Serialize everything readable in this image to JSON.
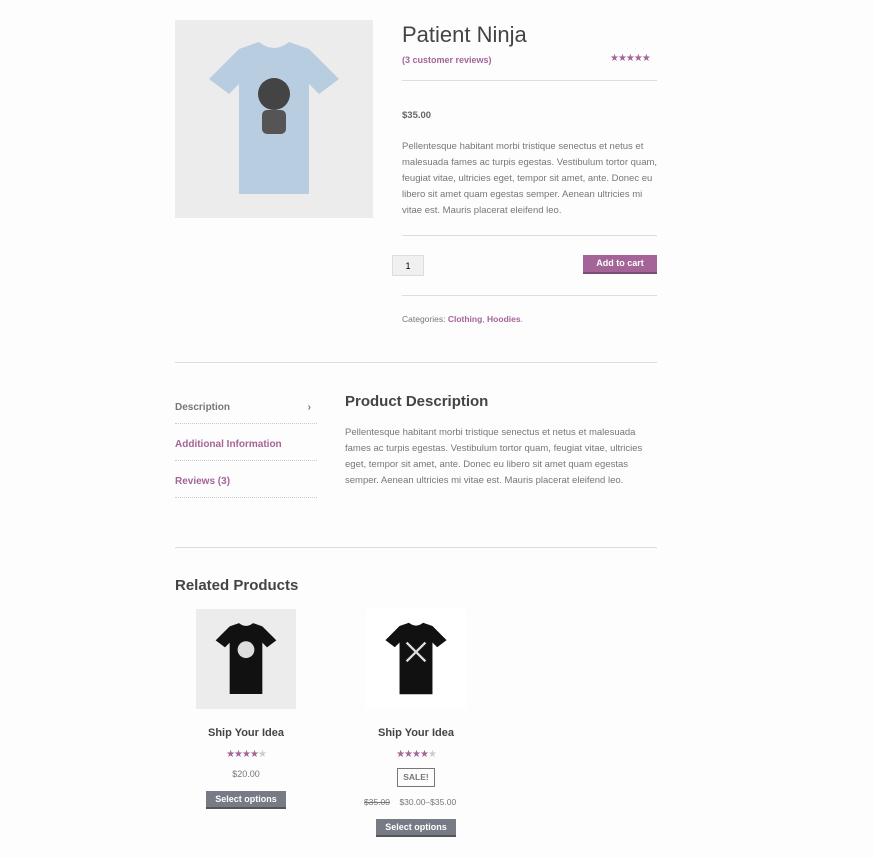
{
  "product": {
    "title": "Patient Ninja",
    "reviews_link": "(3 customer reviews)",
    "rating": 4.67,
    "price": "$35.00",
    "description": "Pellentesque habitant morbi tristique senectus et netus et malesuada fames ac turpis egestas. Vestibulum tortor quam, feugiat vitae, ultricies eget, tempor sit amet, ante. Donec eu libero sit amet quam egestas semper. Aenean ultricies mi vitae est. Mauris placerat eleifend leo.",
    "quantity": "1",
    "add_to_cart": "Add to cart",
    "categories_label": "Categories:",
    "categories": [
      "Clothing",
      "Hoodies"
    ]
  },
  "tabs": [
    {
      "label": "Description",
      "chevron": "›"
    },
    {
      "label": "Additional Information"
    },
    {
      "label": "Reviews (3)"
    }
  ],
  "panel": {
    "title": "Product Description",
    "text": "Pellentesque habitant morbi tristique senectus et netus et malesuada fames ac turpis egestas. Vestibulum tortor quam, feugiat vitae, ultricies eget, tempor sit amet, ante. Donec eu libero sit amet quam egestas semper. Aenean ultricies mi vitae est. Mauris placerat eleifend leo."
  },
  "related": {
    "title": "Related Products",
    "items": [
      {
        "name": "Ship Your Idea",
        "rating": 4.5,
        "price": "$20.00",
        "button": "Select options"
      },
      {
        "name": "Ship Your Idea",
        "rating": 4,
        "sale": "SALE!",
        "old_price": "$35.00",
        "price": "$30.00–$35.00",
        "button": "Select options"
      }
    ]
  },
  "colors": {
    "accent": "#a46497",
    "button": "#777b85"
  }
}
